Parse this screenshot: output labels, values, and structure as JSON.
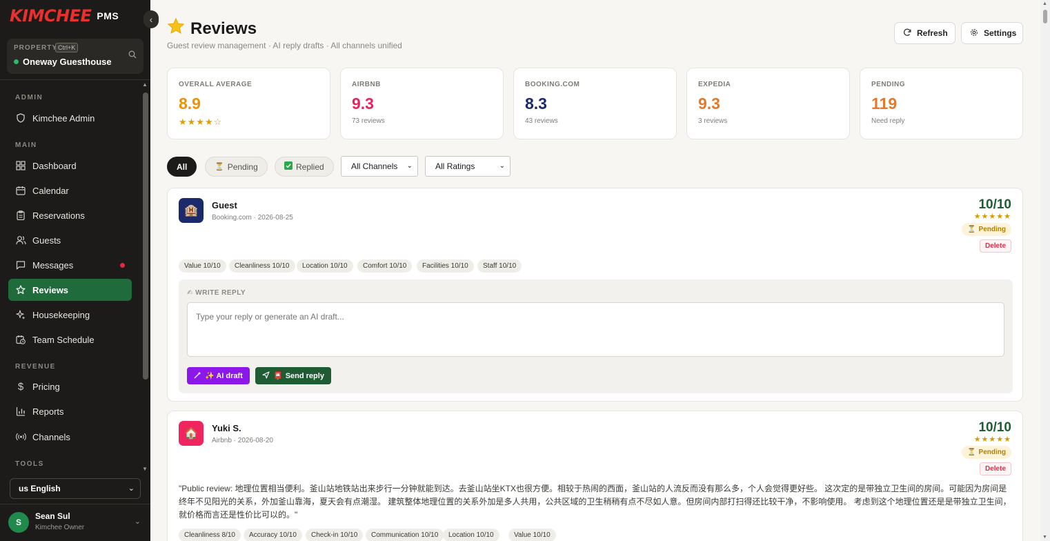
{
  "brand": {
    "logo": "KIMCHEE",
    "suffix": "PMS"
  },
  "property": {
    "label": "PROPERTY",
    "shortcut": "Ctrl+K",
    "name": "Oneway Guesthouse"
  },
  "nav": {
    "admin_label": "ADMIN",
    "main_label": "MAIN",
    "revenue_label": "REVENUE",
    "tools_label": "TOOLS",
    "items": {
      "admin": "Kimchee Admin",
      "dashboard": "Dashboard",
      "calendar": "Calendar",
      "reservations": "Reservations",
      "guests": "Guests",
      "messages": "Messages",
      "reviews": "Reviews",
      "housekeeping": "Housekeeping",
      "team_schedule": "Team Schedule",
      "pricing": "Pricing",
      "reports": "Reports",
      "channels": "Channels"
    }
  },
  "language": {
    "selected": "us English"
  },
  "user": {
    "initial": "S",
    "name": "Sean Sul",
    "role": "Kimchee Owner"
  },
  "header": {
    "title": "Reviews",
    "subtitle": "Guest review management · AI reply drafts · All channels unified",
    "refresh_label": "Refresh",
    "settings_label": "Settings"
  },
  "stats": {
    "overall": {
      "label": "OVERALL AVERAGE",
      "value": "8.9",
      "stars": "★★★★☆",
      "color": "#e8930a"
    },
    "airbnb": {
      "label": "AIRBNB",
      "value": "9.3",
      "sub": "73 reviews",
      "color": "#e5245e"
    },
    "booking": {
      "label": "BOOKING.COM",
      "value": "8.3",
      "sub": "43 reviews",
      "color": "#1c2a6b"
    },
    "expedia": {
      "label": "EXPEDIA",
      "value": "9.3",
      "sub": "3 reviews",
      "color": "#e07a2c"
    },
    "pending": {
      "label": "PENDING",
      "value": "119",
      "sub": "Need reply",
      "color": "#e07a2c"
    }
  },
  "filters": {
    "all": "All",
    "pending": "Pending",
    "replied": "Replied",
    "channel_select": "All Channels",
    "rating_select": "All Ratings"
  },
  "reviews": [
    {
      "name": "Guest",
      "meta": "Booking.com · 2026-08-25",
      "score": "10/10",
      "stars": "★★★★★",
      "status": "Pending",
      "delete_label": "Delete",
      "tags": [
        "Value 10/10",
        "Cleanliness 10/10",
        "Location 10/10",
        "Comfort 10/10",
        "Facilities 10/10",
        "Staff 10/10"
      ],
      "reply_label": "WRITE REPLY",
      "reply_placeholder": "Type your reply or generate an AI draft...",
      "ai_draft_label": "✨ AI draft",
      "send_label": "Send reply",
      "avatar_color": "#1c2a6b"
    },
    {
      "name": "Yuki S.",
      "meta": "Airbnb · 2026-08-20",
      "score": "10/10",
      "stars": "★★★★★",
      "status": "Pending",
      "delete_label": "Delete",
      "text": "\"Public review: 地理位置相当便利。釜山站地铁站出来步行一分钟就能到达。去釜山站坐KTX也很方便。相较于热闹的西面，釜山站的人流反而没有那么多，个人会觉得更好些。 这次定的是带独立卫生间的房间。可能因为房间是终年不见阳光的关系，外加釜山靠海，夏天会有点潮湿。 建筑整体地理位置的关系外加是多人共用，公共区域的卫生稍稍有点不尽如人意。但房间内部打扫得还比较干净，不影响使用。 考虑到这个地理位置还是是带独立卫生间，就价格而言还是性价比可以的。\"",
      "tags": [
        "Cleanliness 8/10",
        "Accuracy 10/10",
        "Check-in 10/10",
        "Communication 10/10",
        "Location 10/10",
        "Value 10/10"
      ],
      "avatar_color": "#f0245e"
    }
  ]
}
